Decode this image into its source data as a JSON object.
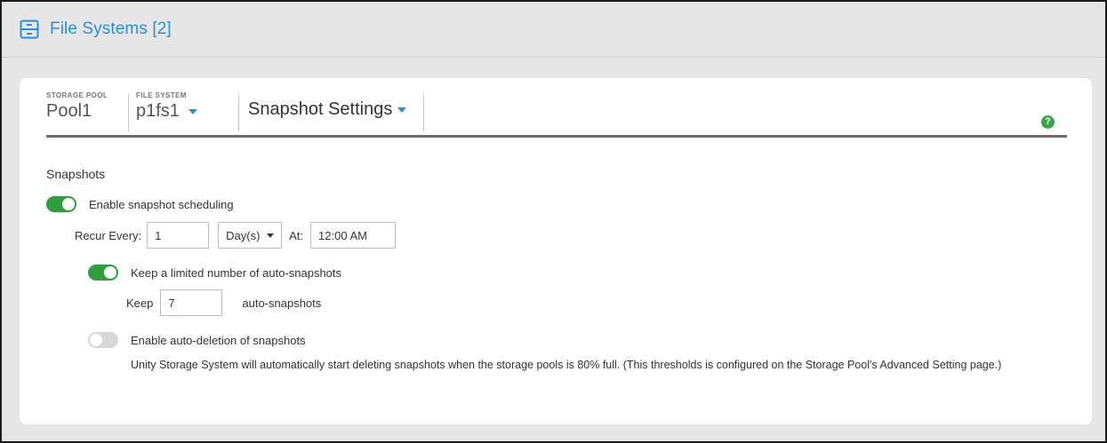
{
  "header": {
    "icon": "file-system-icon",
    "title": "File Systems [2]"
  },
  "breadcrumb": {
    "storage_pool_caption": "STORAGE POOL",
    "storage_pool_value": "Pool1",
    "file_system_caption": "FILE SYSTEM",
    "file_system_value": "p1fs1",
    "view_value": "Snapshot Settings",
    "help_icon": "question-icon",
    "help_glyph": "?"
  },
  "snapshots": {
    "section_title": "Snapshots",
    "enable_scheduling_label": "Enable snapshot scheduling",
    "enable_scheduling_on": true,
    "recur_every_label": "Recur Every:",
    "recur_every_value": "1",
    "recur_unit_value": "Day(s)",
    "at_label": "At:",
    "at_value": "12:00 AM",
    "keep_limited_label": "Keep a limited number of auto-snapshots",
    "keep_limited_on": true,
    "keep_label": "Keep",
    "keep_value": "7",
    "keep_suffix": "auto-snapshots",
    "auto_delete_label": "Enable auto-deletion of snapshots",
    "auto_delete_on": false,
    "auto_delete_note": "Unity Storage System will automatically start deleting snapshots when the storage pools is 80% full. (This thresholds is configured on the Storage Pool's Advanced Setting page.)"
  },
  "colors": {
    "accent": "#2b8fd6",
    "toggle_on": "#2e9e3f",
    "toggle_off": "#d7d7d7",
    "help": "#3aa64a"
  }
}
